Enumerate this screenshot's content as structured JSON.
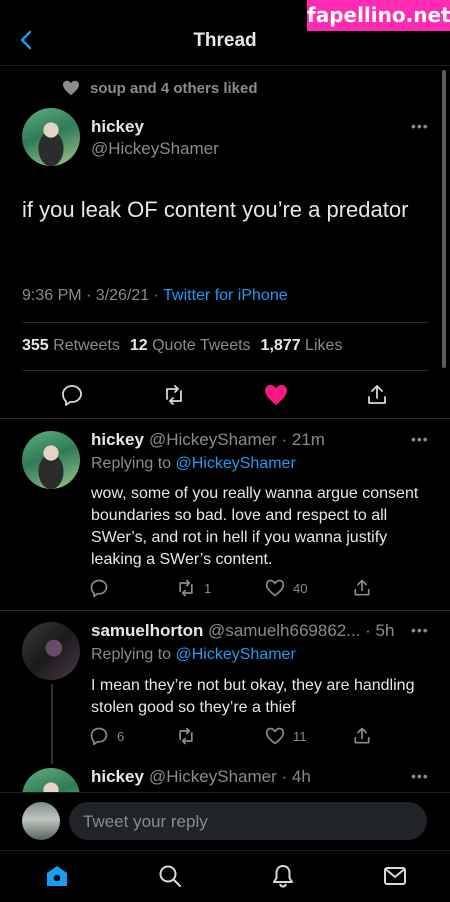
{
  "watermark": "fapellino.net",
  "header": {
    "title": "Thread"
  },
  "social_context": {
    "text": "soup and 4 others liked"
  },
  "main_tweet": {
    "name": "hickey",
    "handle": "@HickeyShamer",
    "text": "if you leak OF content you’re a predator",
    "time": "9:36 PM · 3/26/21 · ",
    "source": "Twitter for iPhone",
    "retweets": "355",
    "retweets_label": "Retweets",
    "quotes": "12",
    "quotes_label": "Quote Tweets",
    "likes": "1,877",
    "likes_label": "Likes"
  },
  "replies": [
    {
      "name": "hickey",
      "handle_time": "@HickeyShamer · 21m",
      "replying_prefix": "Replying to ",
      "replying_to": "@HickeyShamer",
      "text": "wow, some of you really wanna argue consent boundaries so bad. love and respect to all SWer’s, and rot in hell if you wanna justify leaking a SWer’s content.",
      "reply_count": "",
      "retweet_count": "1",
      "like_count": "40"
    },
    {
      "name": "samuelhorton",
      "handle_time": "@samuelh669862... · 5h",
      "replying_prefix": "Replying to ",
      "replying_to": "@HickeyShamer",
      "text": "I mean they’re not but okay, they are handling stolen good so they’re a thief",
      "reply_count": "6",
      "retweet_count": "",
      "like_count": "11"
    },
    {
      "name": "hickey",
      "handle_time": "@HickeyShamer · 4h"
    }
  ],
  "compose": {
    "placeholder": "Tweet your reply"
  },
  "colors": {
    "accent": "#1d9bf0",
    "like": "#f91880",
    "background": "#000000"
  }
}
